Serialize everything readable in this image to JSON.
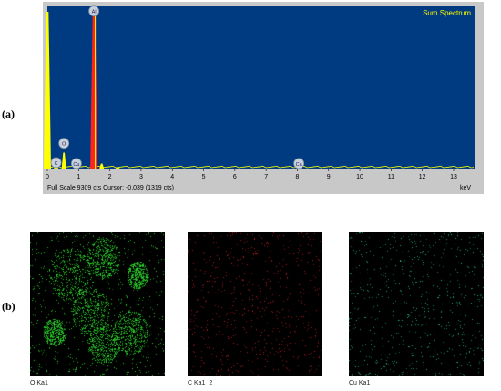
{
  "labels": {
    "a": "(a)",
    "b": "(b)"
  },
  "chart_data": {
    "type": "line",
    "title": "Sum Spectrum",
    "xlabel": "keV",
    "xlim": [
      0,
      13.7
    ],
    "x_ticks": [
      0,
      1,
      2,
      3,
      4,
      5,
      6,
      7,
      8,
      9,
      10,
      11,
      12,
      13
    ],
    "footer": "Full Scale 9309 cts Cursor: -0.039  (1319 cts)",
    "peaks": [
      {
        "x": 0.0,
        "y": 9309,
        "color": "#ffff00"
      },
      {
        "x": 0.28,
        "y": 300,
        "color": "#ffff00"
      },
      {
        "x": 0.53,
        "y": 950,
        "color": "#ffff00"
      },
      {
        "x": 0.93,
        "y": 120,
        "color": "#ffff00"
      },
      {
        "x": 1.49,
        "y": 9300,
        "color": "#ff2222"
      },
      {
        "x": 1.74,
        "y": 300,
        "color": "#ffff00"
      },
      {
        "x": 2.25,
        "y": 80,
        "color": "#ffff00"
      },
      {
        "x": 8.05,
        "y": 40,
        "color": "#ffff00"
      }
    ],
    "element_markers": [
      {
        "x": 0.28,
        "y": 300,
        "label": "C"
      },
      {
        "x": 0.53,
        "y": 1450,
        "label": "O"
      },
      {
        "x": 0.93,
        "y": 250,
        "label": "Cu"
      },
      {
        "x": 1.49,
        "y": 9300,
        "label": "Al"
      },
      {
        "x": 8.05,
        "y": 250,
        "label": "Cu"
      }
    ],
    "colors": {
      "background": "#003a80",
      "frame": "#c8c8c8",
      "title": "#ffff00",
      "trace": "#ffff00",
      "highlight": "#ff2222"
    }
  },
  "maps": [
    {
      "caption": "O Ka1",
      "color": "#2bd42b",
      "density": "high"
    },
    {
      "caption": "C Ka1_2",
      "color": "#c01f1f",
      "density": "low"
    },
    {
      "caption": "Cu Ka1",
      "color": "#22b08a",
      "density": "low"
    }
  ]
}
